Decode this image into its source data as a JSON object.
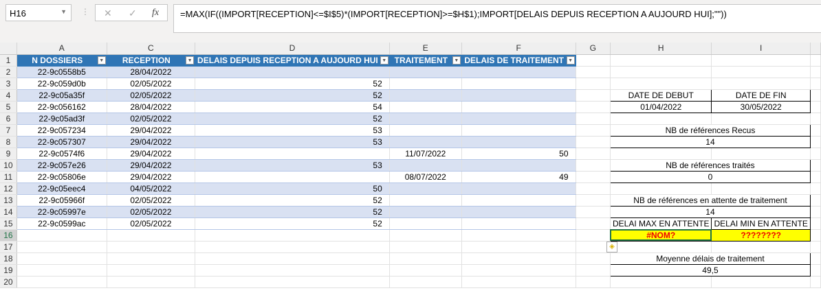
{
  "name_box": "H16",
  "formula_bar": {
    "cancel": "✕",
    "enter": "✓",
    "fx": "fx",
    "formula": "=MAX(IF((IMPORT[RECEPTION]<=$I$5)*(IMPORT[RECEPTION]>=$H$1);IMPORT[DELAIS DEPUIS RECEPTION A AUJOURD HUI];\"\"))"
  },
  "columns": [
    "A",
    "C",
    "D",
    "E",
    "F",
    "G",
    "H",
    "I"
  ],
  "rows": [
    "1",
    "2",
    "3",
    "4",
    "5",
    "6",
    "7",
    "8",
    "9",
    "10",
    "11",
    "12",
    "13",
    "14",
    "15",
    "16",
    "17",
    "18",
    "19",
    "20"
  ],
  "table": {
    "headers": [
      "N DOSSIERS",
      "RECEPTION",
      "DELAIS DEPUIS RECEPTION A AUJOURD HUI",
      "TRAITEMENT",
      "DELAIS DE TRAITEMENT"
    ],
    "rows": [
      [
        "22-9c0558b5",
        "28/04/2022",
        "",
        "",
        ""
      ],
      [
        "22-9c059d0b",
        "02/05/2022",
        "52",
        "",
        ""
      ],
      [
        "22-9c05a35f",
        "02/05/2022",
        "52",
        "",
        ""
      ],
      [
        "22-9c056162",
        "28/04/2022",
        "54",
        "",
        ""
      ],
      [
        "22-9c05ad3f",
        "02/05/2022",
        "52",
        "",
        ""
      ],
      [
        "22-9c057234",
        "29/04/2022",
        "53",
        "",
        ""
      ],
      [
        "22-9c057307",
        "29/04/2022",
        "53",
        "",
        ""
      ],
      [
        "22-9c0574f6",
        "29/04/2022",
        "",
        "11/07/2022",
        "50"
      ],
      [
        "22-9c057e26",
        "29/04/2022",
        "53",
        "",
        ""
      ],
      [
        "22-9c05806e",
        "29/04/2022",
        "",
        "08/07/2022",
        "49"
      ],
      [
        "22-9c05eec4",
        "04/05/2022",
        "50",
        "",
        ""
      ],
      [
        "22-9c05966f",
        "02/05/2022",
        "52",
        "",
        ""
      ],
      [
        "22-9c05997e",
        "02/05/2022",
        "52",
        "",
        ""
      ],
      [
        "22-9c0599ac",
        "02/05/2022",
        "52",
        "",
        ""
      ]
    ]
  },
  "summary": {
    "date_debut_label": "DATE DE DEBUT",
    "date_fin_label": "DATE DE FIN",
    "date_debut": "01/04/2022",
    "date_fin": "30/05/2022",
    "recus_label": "NB de références Recus",
    "recus": "14",
    "traites_label": "NB de références traités",
    "traites": "0",
    "attente_label": "NB de références en attente de traitement",
    "attente": "14",
    "max_label": "DELAI MAX EN ATTENTE",
    "min_label": "DELAI MIN EN ATTENTE",
    "max_value": "#NOM?",
    "min_value": "????????",
    "moyenne_label": "Moyenne délais de traitement",
    "moyenne": "49,5"
  }
}
